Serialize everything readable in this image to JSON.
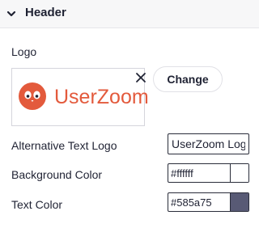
{
  "section": {
    "title": "Header",
    "expanded_icon": "chevron-down-icon"
  },
  "logo": {
    "label": "Logo",
    "brand_text": "UserZoom",
    "brand_color": "#e35a3c",
    "remove_icon": "close-icon",
    "change_label": "Change"
  },
  "alt_text": {
    "label": "Alternative Text Logo",
    "value": "UserZoom Logo"
  },
  "background_color": {
    "label": "Background Color",
    "value": "#ffffff",
    "swatch": "#ffffff"
  },
  "text_color": {
    "label": "Text Color",
    "value": "#585a75",
    "swatch": "#585a75"
  }
}
